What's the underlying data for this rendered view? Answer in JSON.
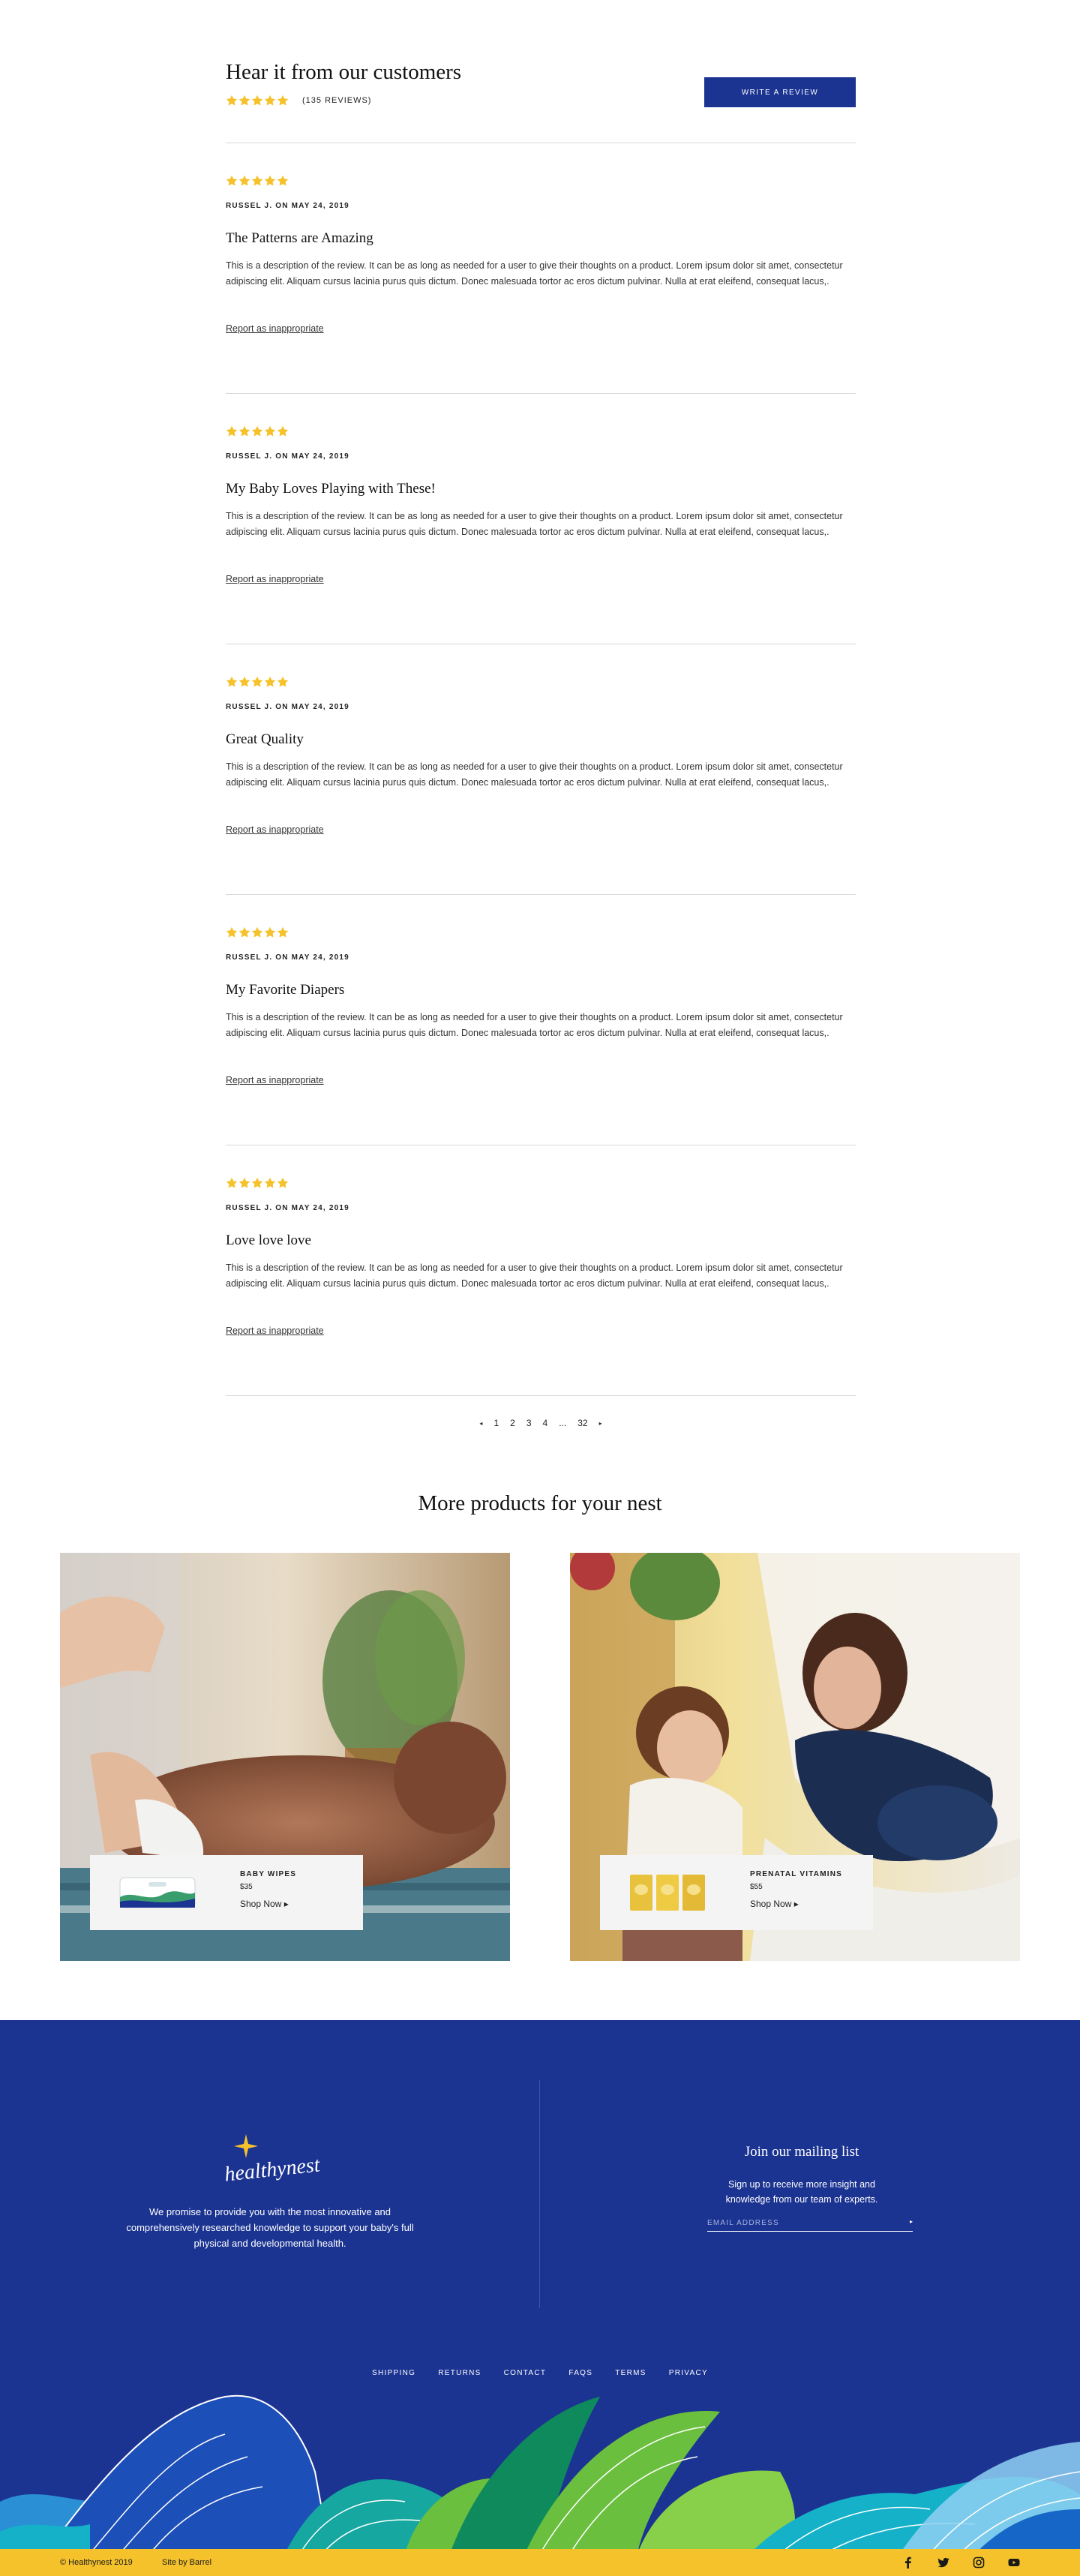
{
  "reviews_section": {
    "title": "Hear it from our customers",
    "rating": 5,
    "count_label": "(135 REVIEWS)",
    "write_button": "WRITE A REVIEW",
    "star_color": "#f5c22c"
  },
  "reviews": [
    {
      "stars": 5,
      "author": "RUSSEL J. ON MAY 24, 2019",
      "title": "The Patterns are Amazing",
      "body": "This is a description of the review. It can be as long as needed for a user to give their thoughts on a product. Lorem ipsum dolor sit amet, consectetur adipiscing elit. Aliquam cursus lacinia purus quis dictum. Donec malesuada tortor ac eros dictum pulvinar. Nulla at erat eleifend, consequat lacus,.",
      "report": "Report as inappropriate"
    },
    {
      "stars": 5,
      "author": "RUSSEL J. ON MAY 24, 2019",
      "title": "My Baby Loves Playing with These!",
      "body": "This is a description of the review. It can be as long as needed for a user to give their thoughts on a product. Lorem ipsum dolor sit amet, consectetur adipiscing elit. Aliquam cursus lacinia purus quis dictum. Donec malesuada tortor ac eros dictum pulvinar. Nulla at erat eleifend, consequat lacus,.",
      "report": "Report as inappropriate"
    },
    {
      "stars": 5,
      "author": "RUSSEL J. ON MAY 24, 2019",
      "title": "Great Quality",
      "body": "This is a description of the review. It can be as long as needed for a user to give their thoughts on a product. Lorem ipsum dolor sit amet, consectetur adipiscing elit. Aliquam cursus lacinia purus quis dictum. Donec malesuada tortor ac eros dictum pulvinar. Nulla at erat eleifend, consequat lacus,.",
      "report": "Report as inappropriate"
    },
    {
      "stars": 5,
      "author": "RUSSEL J. ON MAY 24, 2019",
      "title": "My Favorite Diapers",
      "body": "This is a description of the review. It can be as long as needed for a user to give their thoughts on a product. Lorem ipsum dolor sit amet, consectetur adipiscing elit. Aliquam cursus lacinia purus quis dictum. Donec malesuada tortor ac eros dictum pulvinar. Nulla at erat eleifend, consequat lacus,.",
      "report": "Report as inappropriate"
    },
    {
      "stars": 5,
      "author": "RUSSEL J. ON MAY 24, 2019",
      "title": "Love love love",
      "body": "This is a description of the review. It can be as long as needed for a user to give their thoughts on a product. Lorem ipsum dolor sit amet, consectetur adipiscing elit. Aliquam cursus lacinia purus quis dictum. Donec malesuada tortor ac eros dictum pulvinar. Nulla at erat eleifend, consequat lacus,.",
      "report": "Report as inappropriate"
    }
  ],
  "pagination": {
    "prev_icon": "chevron-left-icon",
    "pages": [
      "1",
      "2",
      "3",
      "4",
      "...",
      "32"
    ],
    "next_icon": "chevron-right-icon"
  },
  "more_products": {
    "title": "More products for your nest",
    "items": [
      {
        "name": "BABY WIPES",
        "price": "$35",
        "cta": "Shop Now ▸",
        "image": "baby-on-changing-mat-photo"
      },
      {
        "name": "PRENATAL VITAMINS",
        "price": "$55",
        "cta": "Shop Now ▸",
        "image": "mother-and-child-hammock-photo"
      }
    ]
  },
  "footer": {
    "brand": "healthynest",
    "promise": "We promise to provide you with the most innovative and comprehensively researched knowledge to support your baby's full physical and developmental health.",
    "mailing_title": "Join our mailing list",
    "mailing_sub": "Sign up to receive more insight and knowledge from our team of experts.",
    "email_placeholder": "EMAIL ADDRESS",
    "nav": [
      "SHIPPING",
      "RETURNS",
      "CONTACT",
      "FAQS",
      "TERMS",
      "PRIVACY"
    ],
    "copyright": "© Healthynest 2019",
    "site_by": "Site by Barrel",
    "social": [
      "facebook-icon",
      "twitter-icon",
      "instagram-icon",
      "youtube-icon"
    ],
    "colors": {
      "background": "#1b3391",
      "bar": "#f5c22c"
    }
  }
}
